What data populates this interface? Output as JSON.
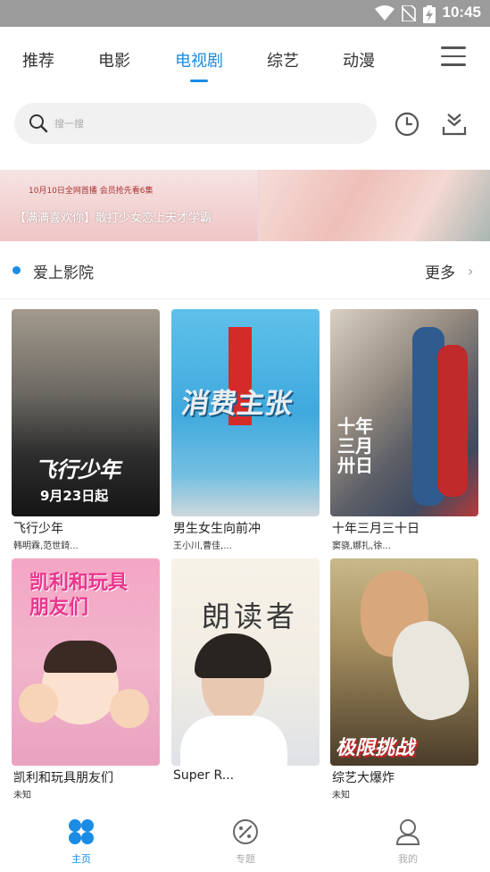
{
  "status_bar": {
    "time": "10:45"
  },
  "tabs": [
    {
      "label": "推荐",
      "active": false
    },
    {
      "label": "电影",
      "active": false
    },
    {
      "label": "电视剧",
      "active": true
    },
    {
      "label": "综艺",
      "active": false
    },
    {
      "label": "动漫",
      "active": false
    }
  ],
  "search": {
    "placeholder": "搜一搜"
  },
  "banner": {
    "subtitle": "10月10日全网首播 会员抢先看6集",
    "caption": "【满满喜欢你】散打少女恋上天才学霸"
  },
  "section": {
    "title": "爱上影院",
    "more": "更多"
  },
  "cards": [
    {
      "title": "飞行少年",
      "cast": "韩明霖,范世錡...",
      "poster_text": "飞行少年",
      "poster_date": "9月23日起"
    },
    {
      "title": "男生女生向前冲",
      "cast": "王小川,曹佳,...",
      "poster_text": "消费主张"
    },
    {
      "title": "十年三月三十日",
      "cast": "窦骁,娜扎,徐...",
      "poster_text": "十年三月卅日"
    },
    {
      "title": "凯利和玩具朋友们",
      "cast": "未知",
      "poster_text": "凯利和玩具朋友们"
    },
    {
      "title": "Super R...",
      "cast": "",
      "poster_text": "朗读者"
    },
    {
      "title": "综艺大爆炸",
      "cast": "未知",
      "poster_text": "极限挑战"
    }
  ],
  "bottom_nav": [
    {
      "label": "主页",
      "icon": "home-grid-icon",
      "active": true
    },
    {
      "label": "专题",
      "icon": "topic-palette-icon",
      "active": false
    },
    {
      "label": "我的",
      "icon": "user-icon",
      "active": false
    }
  ],
  "colors": {
    "accent": "#1a8ce6",
    "status_bar": "#9b9b9b"
  }
}
